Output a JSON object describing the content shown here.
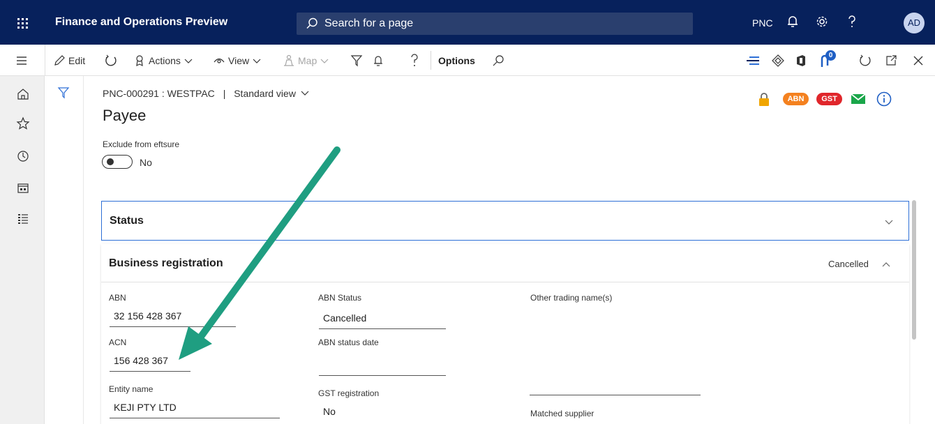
{
  "topbar": {
    "app_title": "Finance and Operations Preview",
    "search_placeholder": "Search for a page",
    "company": "PNC",
    "avatar_initials": "AD"
  },
  "actionbar": {
    "edit": "Edit",
    "actions": "Actions",
    "view": "View",
    "map": "Map",
    "options": "Options",
    "notification_count": "0"
  },
  "header": {
    "breadcrumb_record": "PNC-000291 : WESTPAC",
    "breadcrumb_sep": "|",
    "breadcrumb_view": "Standard view",
    "title": "Payee",
    "badges": {
      "abn": "ABN",
      "gst": "GST"
    }
  },
  "exclude": {
    "label": "Exclude from eftsure",
    "value": "No"
  },
  "status_panel": {
    "title": "Status"
  },
  "business_registration": {
    "title": "Business registration",
    "summary": "Cancelled",
    "fields": {
      "abn_label": "ABN",
      "abn_value": "32 156 428 367",
      "acn_label": "ACN",
      "acn_value": "156 428 367",
      "entity_label": "Entity name",
      "entity_value": "KEJI PTY LTD",
      "abn_status_label": "ABN Status",
      "abn_status_value": "Cancelled",
      "abn_status_date_label": "ABN status date",
      "abn_status_date_value": "",
      "gst_label": "GST registration",
      "gst_value": "No",
      "other_trading_label": "Other trading name(s)",
      "other_trading_value": "",
      "matched_supplier_label": "Matched supplier"
    }
  },
  "colors": {
    "nav_bg": "#07215c",
    "accent": "#2d6fd6",
    "abn_badge": "#f4811f",
    "gst_badge": "#e0262b",
    "email_icon": "#1aa64a",
    "lock_icon": "#f0a500",
    "arrow": "#1f9e81"
  }
}
